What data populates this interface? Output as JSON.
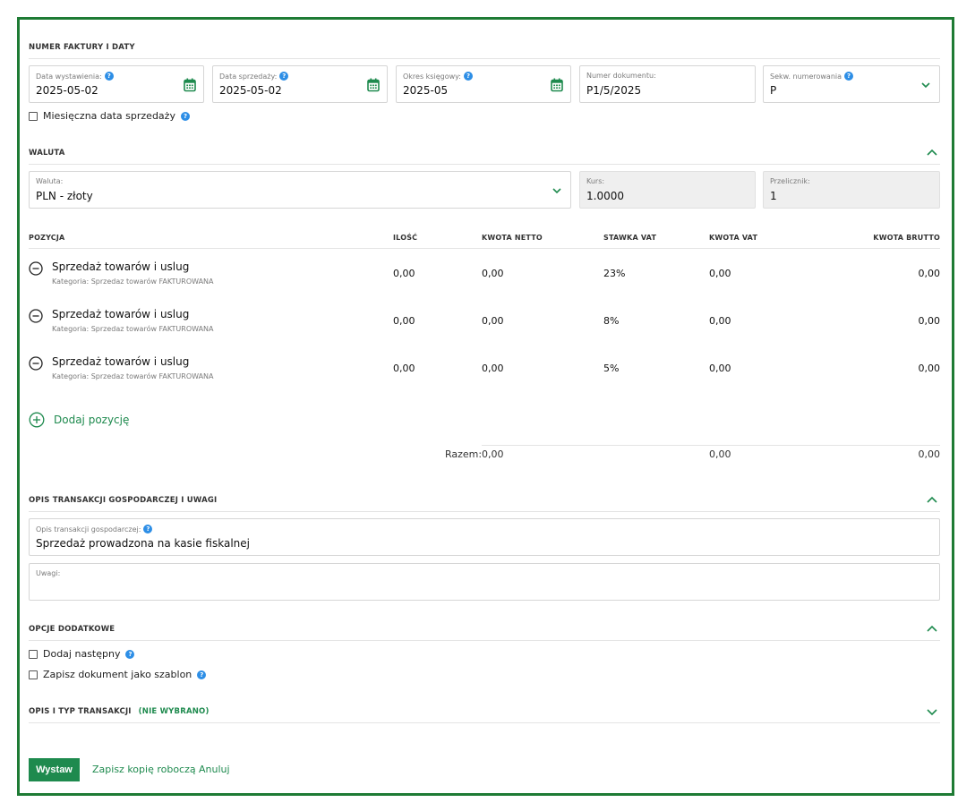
{
  "sections": {
    "invoice_dates": {
      "title": "NUMER FAKTURY I DATY"
    },
    "currency": {
      "title": "WALUTA"
    },
    "description": {
      "title": "OPIS TRANSAKCJI GOSPODARCZEJ I UWAGI"
    },
    "options": {
      "title": "OPCJE DODATKOWE"
    },
    "transaction_type": {
      "title": "OPIS I TYP TRANSAKCJI",
      "status": "(NIE WYBRANO)"
    }
  },
  "invoice_fields": {
    "issue_date": {
      "label": "Data wystawienia:",
      "value": "2025-05-02"
    },
    "sale_date": {
      "label": "Data sprzedaży:",
      "value": "2025-05-02"
    },
    "accounting_period": {
      "label": "Okres księgowy:",
      "value": "2025-05"
    },
    "document_number": {
      "label": "Numer dokumentu:",
      "value": "P1/5/2025"
    },
    "numbering_sequence": {
      "label": "Sekw. numerowania",
      "value": "P"
    }
  },
  "monthly_sale_date": {
    "label": "Miesięczna data sprzedaży",
    "checked": false
  },
  "currency_fields": {
    "currency": {
      "label": "Waluta:",
      "value": "PLN - złoty"
    },
    "rate": {
      "label": "Kurs:",
      "value": "1.0000"
    },
    "converter": {
      "label": "Przelicznik:",
      "value": "1"
    }
  },
  "table": {
    "headers": {
      "position": "POZYCJA",
      "quantity": "ILOŚĆ",
      "net": "KWOTA NETTO",
      "vat_rate": "STAWKA VAT",
      "vat_amount": "KWOTA VAT",
      "gross": "KWOTA BRUTTO"
    },
    "rows": [
      {
        "name": "Sprzedaż towarów i uslug",
        "category": "Kategoria: Sprzedaz towarów FAKTUROWANA",
        "quantity": "0,00",
        "net": "0,00",
        "vat_rate": "23%",
        "vat_amount": "0,00",
        "gross": "0,00"
      },
      {
        "name": "Sprzedaż towarów i uslug",
        "category": "Kategoria: Sprzedaz towarów FAKTUROWANA",
        "quantity": "0,00",
        "net": "0,00",
        "vat_rate": "8%",
        "vat_amount": "0,00",
        "gross": "0,00"
      },
      {
        "name": "Sprzedaż towarów i uslug",
        "category": "Kategoria: Sprzedaz towarów FAKTUROWANA",
        "quantity": "0,00",
        "net": "0,00",
        "vat_rate": "5%",
        "vat_amount": "0,00",
        "gross": "0,00"
      }
    ],
    "add_label": "Dodaj pozycję",
    "totals": {
      "label": "Razem:",
      "net": "0,00",
      "vat_amount": "0,00",
      "gross": "0,00"
    }
  },
  "description_fields": {
    "transaction_description": {
      "label": "Opis transakcji gospodarczej:",
      "value": "Sprzedaż prowadzona na kasie fiskalnej"
    },
    "notes": {
      "label": "Uwagi:",
      "value": ""
    }
  },
  "options": {
    "add_next": {
      "label": "Dodaj następny",
      "checked": false
    },
    "save_as_template": {
      "label": "Zapisz dokument jako szablon",
      "checked": false
    }
  },
  "actions": {
    "issue": "Wystaw",
    "save_draft": "Zapisz kopię roboczą",
    "cancel": "Anuluj"
  },
  "help_glyph": "?",
  "colors": {
    "accent": "#1e8a4e",
    "frame": "#1e7b34",
    "help": "#2d8ee6"
  },
  "icons": {
    "calendar": "calendar-icon",
    "chevron_down": "chevron-down-icon",
    "chevron_up": "chevron-up-icon",
    "minus": "minus-circle-icon",
    "plus": "plus-circle-icon",
    "help": "help-icon"
  }
}
